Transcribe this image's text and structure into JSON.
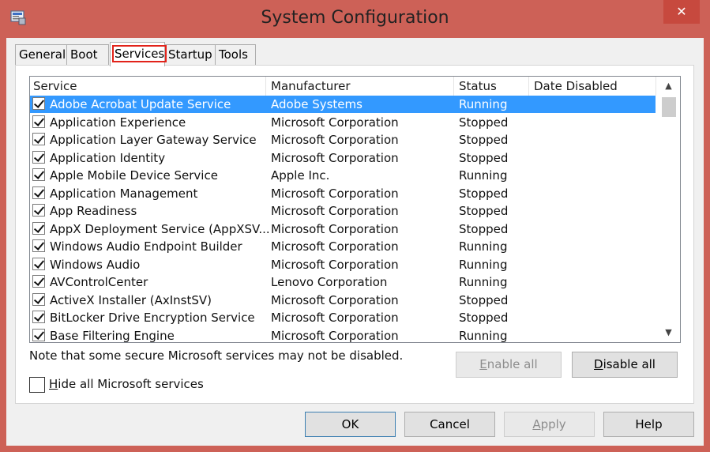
{
  "window": {
    "title": "System Configuration",
    "close_glyph": "✕",
    "accent": "#cd6157"
  },
  "tabs": [
    {
      "label": "General"
    },
    {
      "label": "Boot"
    },
    {
      "label": "Services",
      "active": true
    },
    {
      "label": "Startup"
    },
    {
      "label": "Tools"
    }
  ],
  "columns": {
    "service": "Service",
    "manufacturer": "Manufacturer",
    "status": "Status",
    "date_disabled": "Date Disabled"
  },
  "services": [
    {
      "name": "Adobe Acrobat Update Service",
      "manufacturer": "Adobe Systems",
      "status": "Running",
      "date": "",
      "checked": true,
      "selected": true
    },
    {
      "name": "Application Experience",
      "manufacturer": "Microsoft Corporation",
      "status": "Stopped",
      "date": "",
      "checked": true
    },
    {
      "name": "Application Layer Gateway Service",
      "manufacturer": "Microsoft Corporation",
      "status": "Stopped",
      "date": "",
      "checked": true
    },
    {
      "name": "Application Identity",
      "manufacturer": "Microsoft Corporation",
      "status": "Stopped",
      "date": "",
      "checked": true
    },
    {
      "name": "Apple Mobile Device Service",
      "manufacturer": "Apple Inc.",
      "status": "Running",
      "date": "",
      "checked": true
    },
    {
      "name": "Application Management",
      "manufacturer": "Microsoft Corporation",
      "status": "Stopped",
      "date": "",
      "checked": true
    },
    {
      "name": "App Readiness",
      "manufacturer": "Microsoft Corporation",
      "status": "Stopped",
      "date": "",
      "checked": true
    },
    {
      "name": "AppX Deployment Service (AppXSV...",
      "manufacturer": "Microsoft Corporation",
      "status": "Stopped",
      "date": "",
      "checked": true
    },
    {
      "name": "Windows Audio Endpoint Builder",
      "manufacturer": "Microsoft Corporation",
      "status": "Running",
      "date": "",
      "checked": true
    },
    {
      "name": "Windows Audio",
      "manufacturer": "Microsoft Corporation",
      "status": "Running",
      "date": "",
      "checked": true
    },
    {
      "name": "AVControlCenter",
      "manufacturer": "Lenovo Corporation",
      "status": "Running",
      "date": "",
      "checked": true
    },
    {
      "name": "ActiveX Installer (AxInstSV)",
      "manufacturer": "Microsoft Corporation",
      "status": "Stopped",
      "date": "",
      "checked": true
    },
    {
      "name": "BitLocker Drive Encryption Service",
      "manufacturer": "Microsoft Corporation",
      "status": "Stopped",
      "date": "",
      "checked": true
    },
    {
      "name": "Base Filtering Engine",
      "manufacturer": "Microsoft Corporation",
      "status": "Running",
      "date": "",
      "checked": true
    }
  ],
  "note": "Note that some secure Microsoft services may not be disabled.",
  "enable_all": {
    "mnemonic": "E",
    "rest": "nable all"
  },
  "disable_all": {
    "mnemonic": "D",
    "rest": "isable all"
  },
  "hide_ms": {
    "mnemonic": "H",
    "rest": "ide all Microsoft services",
    "checked": false
  },
  "buttons": {
    "ok": "OK",
    "cancel": "Cancel",
    "apply": {
      "mnemonic": "A",
      "rest": "pply"
    },
    "help": "Help"
  }
}
